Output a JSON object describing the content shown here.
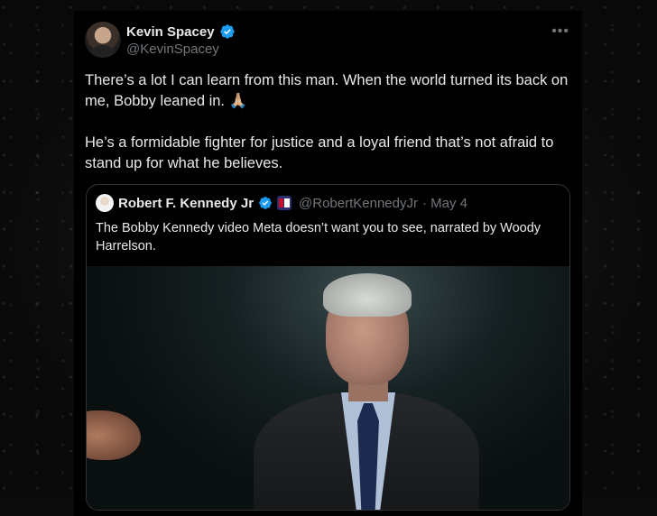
{
  "tweet": {
    "author_name": "Kevin Spacey",
    "author_handle": "@KevinSpacey",
    "more_icon": "more-horizontal-icon",
    "paragraphs": [
      "There’s a lot I can learn from this man. When the world turned its back on me, Bobby leaned in. 🙏🏼",
      "He’s a formidable fighter for justice and a loyal friend that’s not afraid to stand up for what he believes."
    ]
  },
  "quote": {
    "author_name": "Robert F. Kennedy Jr",
    "author_handle": "@RobertKennedyJr",
    "date": "· May 4",
    "text": "The Bobby Kennedy video Meta doesn’t want you to see, narrated by Woody Harrelson."
  },
  "colors": {
    "verified_blue": "#1d9bf0",
    "text_primary": "#e7e9ea",
    "text_secondary": "#71767b",
    "border": "#2f3336"
  }
}
